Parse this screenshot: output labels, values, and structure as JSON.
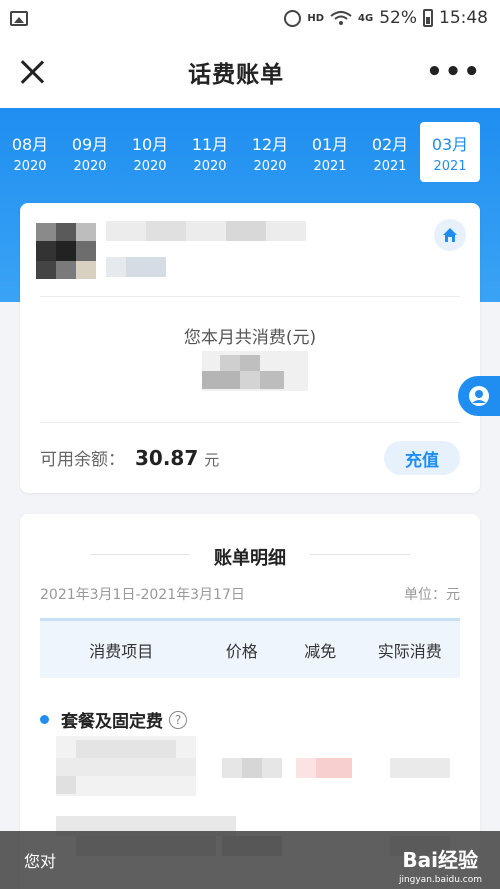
{
  "status_bar": {
    "hd": "HD",
    "signal": "4G",
    "battery": "52%",
    "time": "15:48"
  },
  "header": {
    "title": "话费账单"
  },
  "months": [
    {
      "month": "08月",
      "year": "2020"
    },
    {
      "month": "09月",
      "year": "2020"
    },
    {
      "month": "10月",
      "year": "2020"
    },
    {
      "month": "11月",
      "year": "2020"
    },
    {
      "month": "12月",
      "year": "2020"
    },
    {
      "month": "01月",
      "year": "2021"
    },
    {
      "month": "02月",
      "year": "2021"
    },
    {
      "month": "03月",
      "year": "2021"
    }
  ],
  "active_month_index": 7,
  "summary": {
    "total_label": "您本月共消费(元)",
    "balance_label": "可用余额：",
    "balance_value": "30.87",
    "balance_unit": "元",
    "recharge_label": "充值"
  },
  "detail": {
    "title": "账单明细",
    "period": "2021年3月1日-2021年3月17日",
    "unit": "单位：元",
    "columns": [
      "消费项目",
      "价格",
      "减免",
      "实际消费"
    ],
    "group_label": "套餐及固定费"
  },
  "bottom": {
    "text": "您对",
    "watermark": "Bai经验",
    "url": "jingyan.baidu.com"
  },
  "colors": {
    "accent": "#1f8ef0"
  }
}
